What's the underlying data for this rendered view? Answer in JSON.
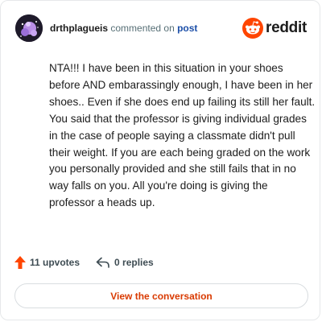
{
  "comment": {
    "username": "drthplagueis",
    "action_text": "commented on",
    "post_link_label": "post",
    "body": "NTA!!! I have been in this situation in your shoes before AND embarassingly enough, I have been in her shoes.. Even if she does end up failing its still her fault. You said that the professor is giving individual grades in the case of people saying a classmate didn't pull their weight. If you are each being graded on the work you personally provided and she still fails that in no way falls on you. All you're doing is giving the professor a heads up."
  },
  "brand": {
    "wordmark": "reddit",
    "icon": "reddit-snoo-icon",
    "color": "#ff4500"
  },
  "actions": {
    "upvotes_label": "11 upvotes",
    "upvote_icon": "upvote-arrow-icon",
    "replies_label": "0 replies",
    "reply_icon": "reply-arrow-icon"
  },
  "cta": {
    "label": "View the conversation",
    "color": "#d93a00"
  }
}
